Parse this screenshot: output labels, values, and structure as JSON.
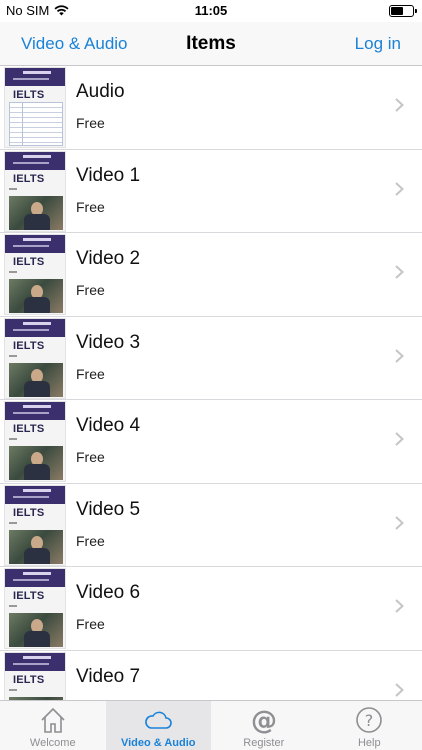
{
  "status_bar": {
    "carrier": "No SIM",
    "time": "11:05"
  },
  "navbar": {
    "back_label": "Video & Audio",
    "title": "Items",
    "login_label": "Log in"
  },
  "thumbnail": {
    "brand": "IELTS"
  },
  "items": [
    {
      "title": "Audio",
      "price": "Free",
      "thumb": "table"
    },
    {
      "title": "Video 1",
      "price": "Free",
      "thumb": "photo"
    },
    {
      "title": "Video 2",
      "price": "Free",
      "thumb": "photo"
    },
    {
      "title": "Video 3",
      "price": "Free",
      "thumb": "photo"
    },
    {
      "title": "Video 4",
      "price": "Free",
      "thumb": "photo"
    },
    {
      "title": "Video 5",
      "price": "Free",
      "thumb": "photo"
    },
    {
      "title": "Video 6",
      "price": "Free",
      "thumb": "photo"
    },
    {
      "title": "Video 7",
      "price": "",
      "thumb": "photo"
    }
  ],
  "tabbar": {
    "tabs": [
      {
        "label": "Welcome",
        "icon": "house-icon",
        "active": false
      },
      {
        "label": "Video & Audio",
        "icon": "cloud-icon",
        "active": true
      },
      {
        "label": "Register",
        "icon": "at-sign-icon",
        "active": false
      },
      {
        "label": "Help",
        "icon": "question-circle-icon",
        "active": false
      }
    ]
  },
  "colors": {
    "accent": "#1a82d8",
    "inactive": "#8e8e93",
    "thumb_band": "#3c2f6d"
  }
}
